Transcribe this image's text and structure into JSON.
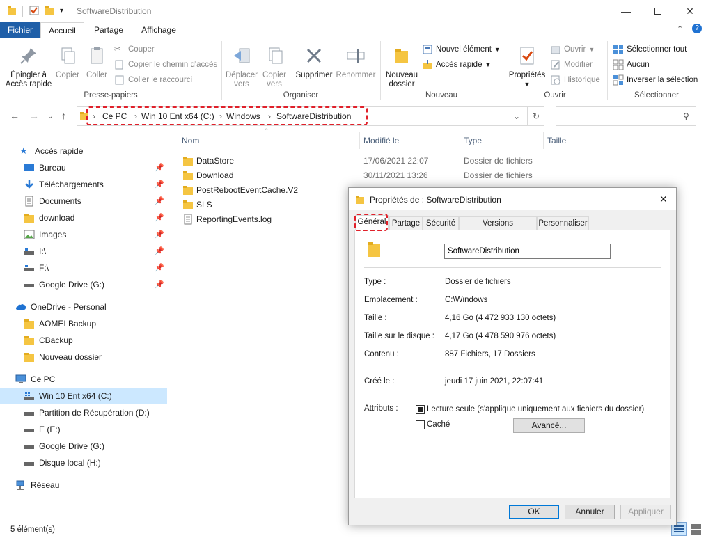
{
  "window": {
    "title": "SoftwareDistribution",
    "minimize_icon": "minimize-icon",
    "maximize_icon": "maximize-icon",
    "close_icon": "close-icon"
  },
  "ribbon_tabs": [
    "Fichier",
    "Accueil",
    "Partage",
    "Affichage"
  ],
  "ribbon": {
    "presse_papiers": {
      "label": "Presse-papiers",
      "pin_l1": "Épingler à",
      "pin_l2": "Accès rapide",
      "copier": "Copier",
      "coller": "Coller",
      "couper": "Couper",
      "copier_chemin": "Copier le chemin d'accès",
      "coller_raccourci": "Coller le raccourci"
    },
    "organiser": {
      "label": "Organiser",
      "deplacer_l1": "Déplacer",
      "deplacer_l2": "vers",
      "copier_l1": "Copier",
      "copier_l2": "vers",
      "supprimer": "Supprimer",
      "renommer": "Renommer"
    },
    "nouveau": {
      "label": "Nouveau",
      "dossier_l1": "Nouveau",
      "dossier_l2": "dossier",
      "element": "Nouvel élément",
      "acces": "Accès rapide"
    },
    "ouvrir": {
      "label": "Ouvrir",
      "proprietes": "Propriétés",
      "ouvrir": "Ouvrir",
      "modifier": "Modifier",
      "historique": "Historique"
    },
    "selectionner": {
      "label": "Sélectionner",
      "tout": "Sélectionner tout",
      "aucun": "Aucun",
      "inverser": "Inverser la sélection"
    }
  },
  "address": {
    "crumbs": [
      "Ce PC",
      "Win 10 Ent x64 (C:)",
      "Windows",
      "SoftwareDistribution"
    ]
  },
  "sidebar": {
    "items": [
      {
        "label": "Accès rapide",
        "icon": "star-icon"
      },
      {
        "label": "Bureau",
        "icon": "desktop-icon"
      },
      {
        "label": "Téléchargements",
        "icon": "download-icon"
      },
      {
        "label": "Documents",
        "icon": "document-icon"
      },
      {
        "label": "download",
        "icon": "folder-icon"
      },
      {
        "label": "Images",
        "icon": "images-icon"
      },
      {
        "label": "I:\\",
        "icon": "drive-icon"
      },
      {
        "label": "F:\\",
        "icon": "drive-icon"
      },
      {
        "label": "Google Drive (G:)",
        "icon": "drive-icon"
      },
      {
        "label": "OneDrive - Personal",
        "icon": "cloud-icon"
      },
      {
        "label": "AOMEI Backup",
        "icon": "folder-icon"
      },
      {
        "label": "CBackup",
        "icon": "folder-icon"
      },
      {
        "label": "Nouveau dossier",
        "icon": "folder-icon"
      },
      {
        "label": "Ce PC",
        "icon": "computer-icon"
      },
      {
        "label": "Win 10 Ent x64 (C:)",
        "icon": "windows-drive-icon"
      },
      {
        "label": "Partition de Récupération (D:)",
        "icon": "drive-icon"
      },
      {
        "label": "E (E:)",
        "icon": "drive-icon"
      },
      {
        "label": "Google Drive (G:)",
        "icon": "drive-icon"
      },
      {
        "label": "Disque local (H:)",
        "icon": "drive-icon"
      },
      {
        "label": "Réseau",
        "icon": "network-icon"
      }
    ]
  },
  "files": {
    "columns": [
      "Nom",
      "Modifié le",
      "Type",
      "Taille"
    ],
    "rows": [
      {
        "name": "DataStore",
        "date": "17/06/2021 22:07",
        "type": "Dossier de fichiers"
      },
      {
        "name": "Download",
        "date": "30/11/2021 13:26",
        "type": "Dossier de fichiers"
      },
      {
        "name": "PostRebootEventCache.V2",
        "date": "",
        "type": ""
      },
      {
        "name": "SLS",
        "date": "",
        "type": ""
      },
      {
        "name": "ReportingEvents.log",
        "date": "",
        "type": ""
      }
    ]
  },
  "status": {
    "count": "5 élément(s)"
  },
  "dialog": {
    "title": "Propriétés de : SoftwareDistribution",
    "tabs": [
      "Général",
      "Partage",
      "Sécurité",
      "Versions précédentes",
      "Personnaliser"
    ],
    "name_value": "SoftwareDistribution",
    "type_label": "Type :",
    "type_value": "Dossier de fichiers",
    "location_label": "Emplacement :",
    "location_value": "C:\\Windows",
    "size_label": "Taille :",
    "size_value": "4,16 Go (4 472 933 130 octets)",
    "disk_size_label": "Taille sur le disque :",
    "disk_size_value": "4,17 Go (4 478 590 976 octets)",
    "contents_label": "Contenu :",
    "contents_value": "887 Fichiers, 17 Dossiers",
    "created_label": "Créé le :",
    "created_value": "jeudi 17 juin 2021, 22:07:41",
    "attributes_label": "Attributs :",
    "readonly_label": "Lecture seule (s'applique uniquement aux fichiers du dossier)",
    "hidden_label": "Caché",
    "advanced_button": "Avancé...",
    "ok_button": "OK",
    "cancel_button": "Annuler",
    "apply_button": "Appliquer"
  },
  "colors": {
    "accent": "#1f5fa8",
    "selection": "#cce8ff",
    "highlight_dash": "#e0202a",
    "folder": "#f5c542"
  }
}
